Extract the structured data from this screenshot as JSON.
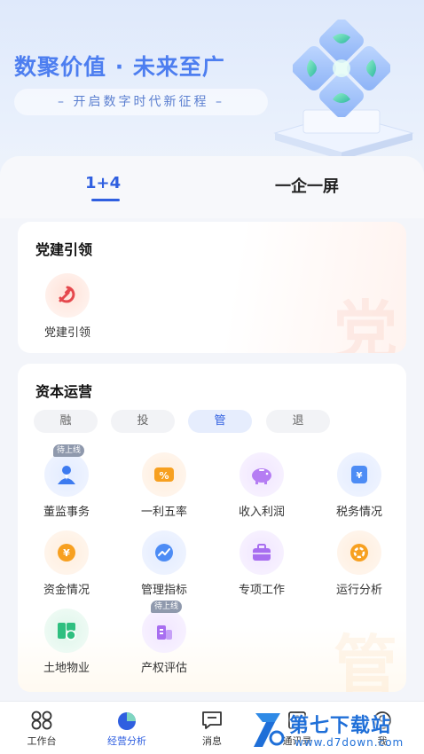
{
  "banner": {
    "title": "数聚价值 · 未来至广",
    "subtitle": "– 开启数字时代新征程 –"
  },
  "tabs": [
    {
      "label": "1+4",
      "active": true
    },
    {
      "label": "一企一屏",
      "active": false
    }
  ],
  "party_section": {
    "title": "党建引领",
    "watermark": "党",
    "items": [
      {
        "label": "党建引领",
        "icon": "party-emblem-icon"
      }
    ]
  },
  "capital_section": {
    "title": "资本运营",
    "watermark": "管",
    "chips": [
      {
        "label": "融",
        "active": false
      },
      {
        "label": "投",
        "active": false
      },
      {
        "label": "管",
        "active": true
      },
      {
        "label": "退",
        "active": false
      }
    ],
    "items": [
      {
        "label": "董监事务",
        "icon": "director-person-icon",
        "badge": "待上线"
      },
      {
        "label": "一利五率",
        "icon": "percent-icon",
        "badge": ""
      },
      {
        "label": "收入利润",
        "icon": "piggy-bank-icon",
        "badge": ""
      },
      {
        "label": "税务情况",
        "icon": "tax-document-icon",
        "badge": ""
      },
      {
        "label": "资金情况",
        "icon": "yuan-coin-icon",
        "badge": ""
      },
      {
        "label": "管理指标",
        "icon": "trend-chart-icon",
        "badge": ""
      },
      {
        "label": "专项工作",
        "icon": "briefcase-icon",
        "badge": ""
      },
      {
        "label": "运行分析",
        "icon": "gear-analysis-icon",
        "badge": ""
      },
      {
        "label": "土地物业",
        "icon": "land-property-icon",
        "badge": ""
      },
      {
        "label": "产权评估",
        "icon": "property-building-icon",
        "badge": "待上线"
      }
    ]
  },
  "bottom_nav": [
    {
      "label": "工作台",
      "icon": "workbench-grid-icon",
      "active": false
    },
    {
      "label": "经营分析",
      "icon": "pie-chart-icon",
      "active": true
    },
    {
      "label": "消息",
      "icon": "message-icon",
      "active": false
    },
    {
      "label": "通讯录",
      "icon": "contacts-icon",
      "active": false
    },
    {
      "label": "我",
      "icon": "profile-icon",
      "active": false
    }
  ],
  "overlay_logo": {
    "name": "第七下载站",
    "url": "www.d7down.com"
  },
  "colors": {
    "accent": "#2f5fe0",
    "banner_title": "#4d7ef0",
    "badge": "#8f99ad"
  }
}
